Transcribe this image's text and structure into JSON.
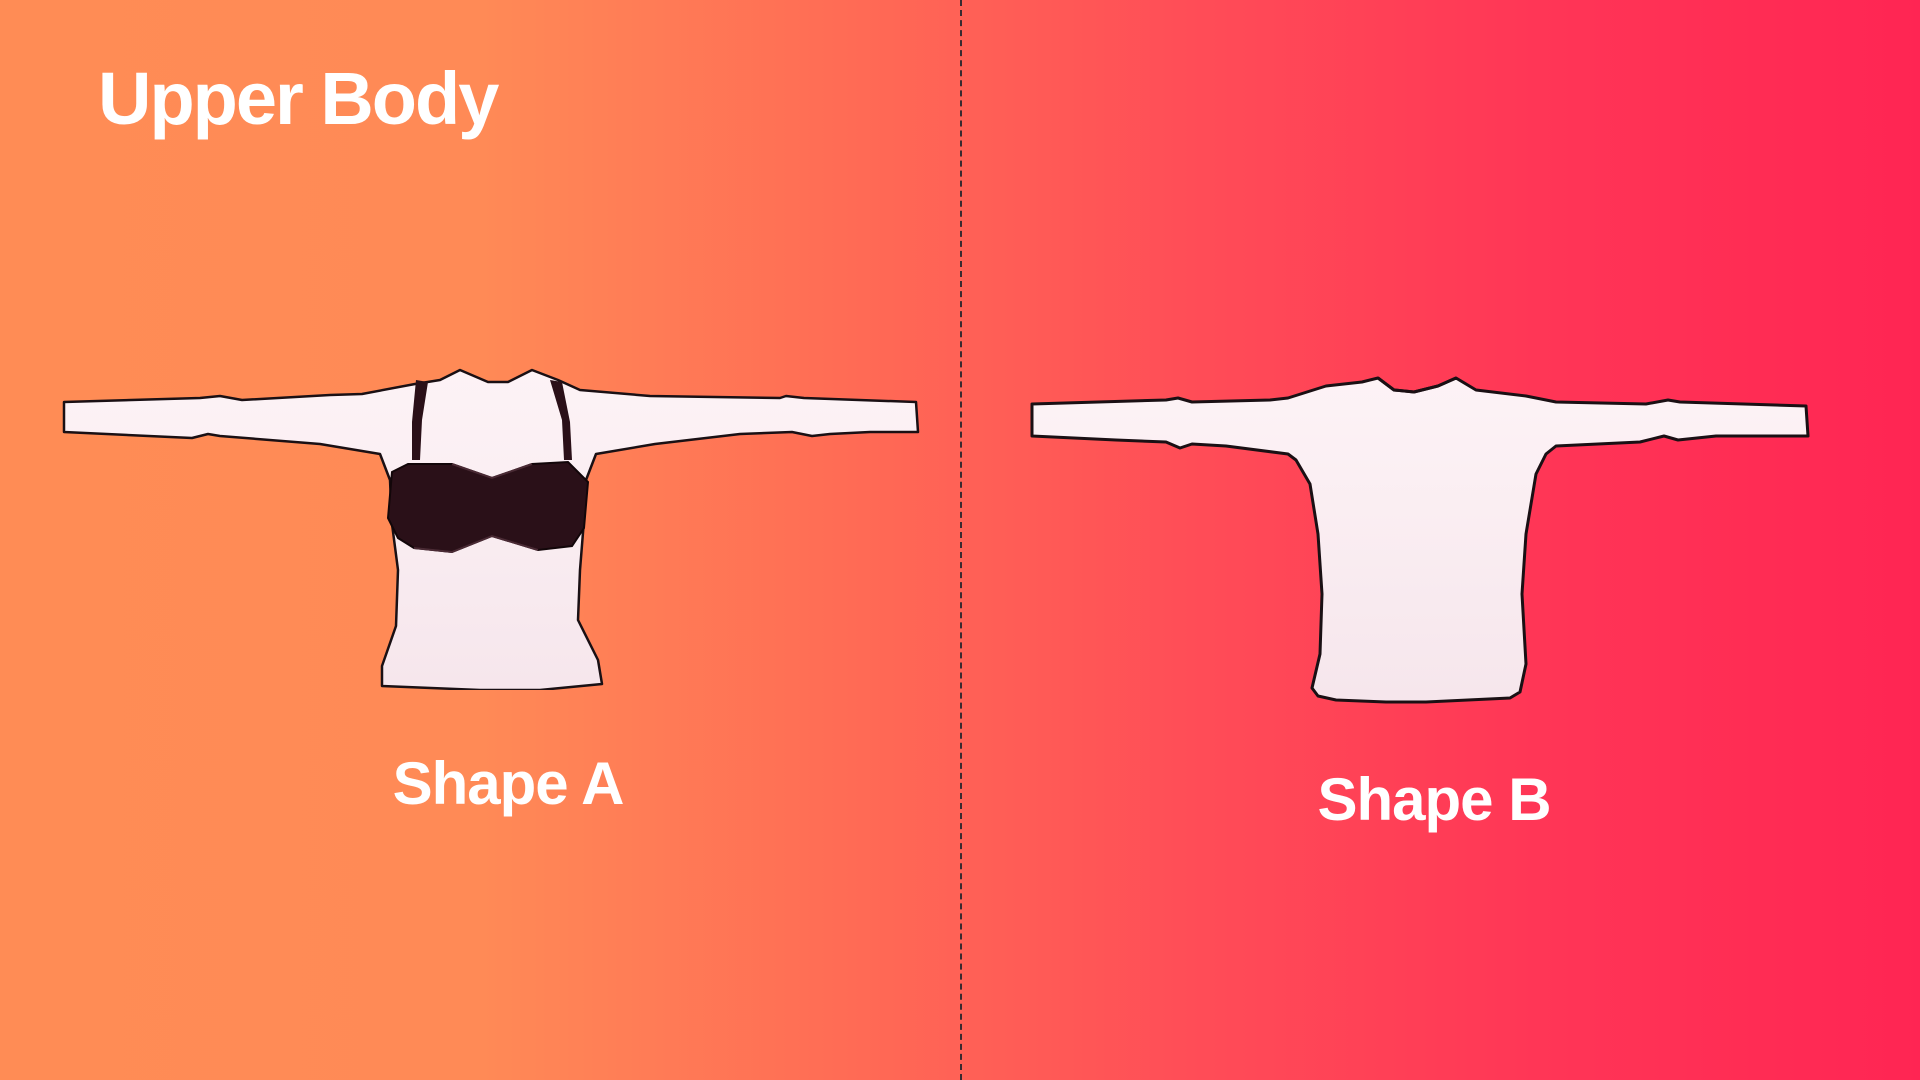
{
  "header": {
    "title": "Upper Body"
  },
  "shapes": [
    {
      "label": "Shape A",
      "has_bra": true
    },
    {
      "label": "Shape B",
      "has_bra": false
    }
  ],
  "colors": {
    "gradient_start": "#ff8c55",
    "gradient_end": "#ff2553",
    "shirt": "#fbeef2",
    "outline": "#1a1014",
    "bra": "#2a1018",
    "divider": "#3a2a30"
  }
}
